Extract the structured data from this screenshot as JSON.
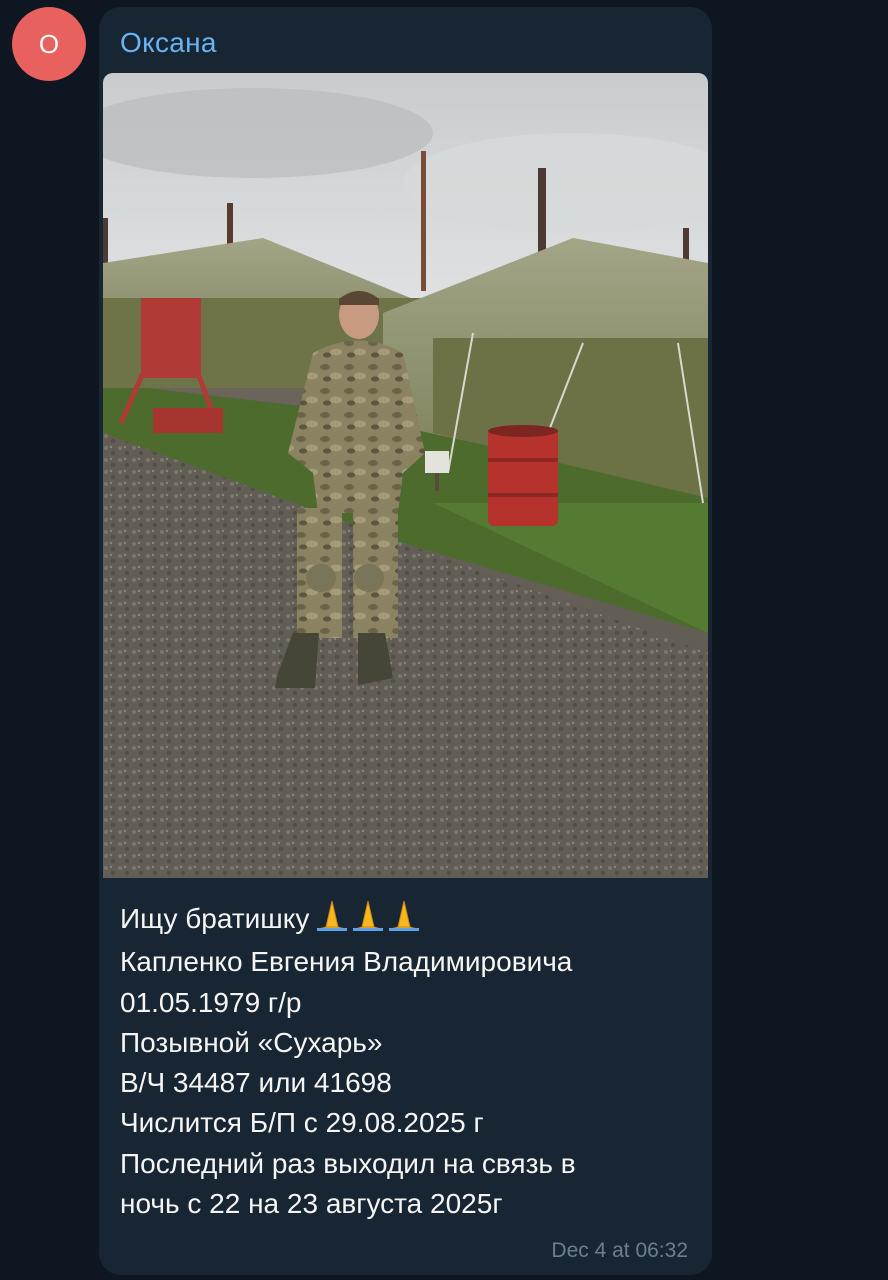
{
  "sender": {
    "avatar_letter": "О",
    "avatar_color": "#e8615f",
    "name": "Оксана",
    "name_color": "#6ab3f3"
  },
  "message": {
    "photo_icon": "photo-of-man-in-camouflage-near-military-tents",
    "emoji": "folded-hands-icon",
    "lines": [
      "Ищу братишку",
      "Капленко Евгения Владимировича",
      "01.05.1979 г/р",
      "Позывной «Сухарь»",
      "В/Ч 34487 или 41698",
      "Числится Б/П с 29.08.2025 г",
      "Последний раз выходил на связь в",
      "ночь с 22 на 23 августа 2025г"
    ],
    "timestamp": "Dec 4 at 06:32"
  },
  "colors": {
    "background": "#0e1621",
    "bubble": "#182533",
    "text": "#f5f5f5",
    "meta": "#6d7f8f"
  }
}
